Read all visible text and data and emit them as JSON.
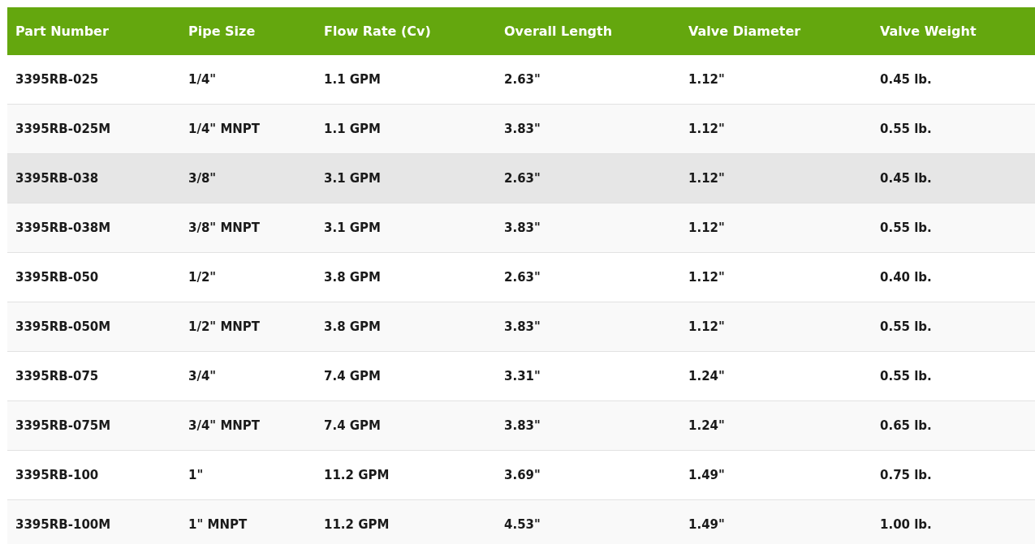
{
  "table": {
    "columns": [
      "Part Number",
      "Pipe Size",
      "Flow Rate (Cv)",
      "Overall Length",
      "Valve Diameter",
      "Valve Weight"
    ],
    "rows": [
      {
        "cells": [
          "3395RB-025",
          "1/4\"",
          "1.1 GPM",
          "2.63\"",
          "1.12\"",
          "0.45 lb."
        ],
        "highlighted": false
      },
      {
        "cells": [
          "3395RB-025M",
          "1/4\" MNPT",
          "1.1 GPM",
          "3.83\"",
          "1.12\"",
          "0.55 lb."
        ],
        "highlighted": false
      },
      {
        "cells": [
          "3395RB-038",
          "3/8\"",
          "3.1 GPM",
          "2.63\"",
          "1.12\"",
          "0.45 lb."
        ],
        "highlighted": true
      },
      {
        "cells": [
          "3395RB-038M",
          "3/8\" MNPT",
          "3.1 GPM",
          "3.83\"",
          "1.12\"",
          "0.55 lb."
        ],
        "highlighted": false
      },
      {
        "cells": [
          "3395RB-050",
          "1/2\"",
          "3.8 GPM",
          "2.63\"",
          "1.12\"",
          "0.40 lb."
        ],
        "highlighted": false
      },
      {
        "cells": [
          "3395RB-050M",
          "1/2\" MNPT",
          "3.8 GPM",
          "3.83\"",
          "1.12\"",
          "0.55 lb."
        ],
        "highlighted": false
      },
      {
        "cells": [
          "3395RB-075",
          "3/4\"",
          "7.4 GPM",
          "3.31\"",
          "1.24\"",
          "0.55 lb."
        ],
        "highlighted": false
      },
      {
        "cells": [
          "3395RB-075M",
          "3/4\" MNPT",
          "7.4 GPM",
          "3.83\"",
          "1.24\"",
          "0.65 lb."
        ],
        "highlighted": false
      },
      {
        "cells": [
          "3395RB-100",
          "1\"",
          "11.2 GPM",
          "3.69\"",
          "1.49\"",
          "0.75 lb."
        ],
        "highlighted": false
      },
      {
        "cells": [
          "3395RB-100M",
          "1\" MNPT",
          "11.2 GPM",
          "4.53\"",
          "1.49\"",
          "1.00 lb."
        ],
        "highlighted": false
      }
    ]
  }
}
